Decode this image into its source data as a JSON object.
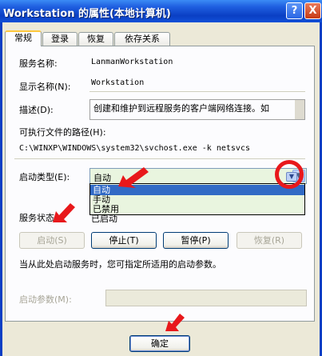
{
  "window": {
    "title": "Workstation 的属性(本地计算机)",
    "help_label": "?",
    "close_label": "X"
  },
  "tabs": [
    {
      "label": "常规"
    },
    {
      "label": "登录"
    },
    {
      "label": "恢复"
    },
    {
      "label": "依存关系"
    }
  ],
  "general": {
    "service_name_label": "服务名称:",
    "service_name_value": "LanmanWorkstation",
    "display_name_label": "显示名称(N):",
    "display_name_value": "Workstation",
    "description_label": "描述(D):",
    "description_value": "创建和维护到远程服务的客户端网络连接。如",
    "exe_path_label": "可执行文件的路径(H):",
    "exe_path_value": "C:\\WINXP\\WINDOWS\\system32\\svchost.exe -k netsvcs",
    "startup_type_label": "启动类型(E):",
    "startup_type_value": "自动",
    "startup_options": [
      "自动",
      "手动",
      "已禁用"
    ],
    "service_status_label": "服务状态",
    "service_status_value": "已启动",
    "hint_text": "当从此处启动服务时，您可指定所适用的启动参数。",
    "start_params_label": "启动参数(M):"
  },
  "buttons": {
    "start": "启动(S)",
    "stop": "停止(T)",
    "pause": "暂停(P)",
    "resume": "恢复(R)",
    "ok": "确定"
  },
  "colors": {
    "accent_red": "#e8181b",
    "selection_blue": "#316ac5",
    "titlebar_blue": "#0a3fc4"
  }
}
